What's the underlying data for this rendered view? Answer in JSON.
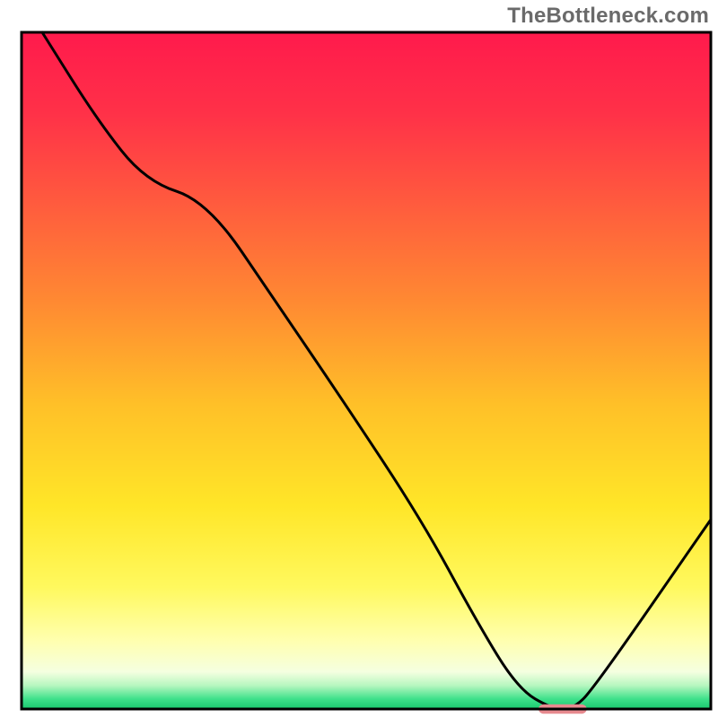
{
  "watermark": "TheBottleneck.com",
  "chart_data": {
    "type": "line",
    "title": "",
    "xlabel": "",
    "ylabel": "",
    "xlim": [
      0,
      100
    ],
    "ylim": [
      0,
      100
    ],
    "grid": false,
    "legend": false,
    "background_gradient": {
      "stops": [
        {
          "offset": 0.0,
          "color": "#ff1a4c"
        },
        {
          "offset": 0.12,
          "color": "#ff3148"
        },
        {
          "offset": 0.25,
          "color": "#ff5a3e"
        },
        {
          "offset": 0.4,
          "color": "#ff8a32"
        },
        {
          "offset": 0.55,
          "color": "#ffc028"
        },
        {
          "offset": 0.7,
          "color": "#ffe628"
        },
        {
          "offset": 0.82,
          "color": "#fff95e"
        },
        {
          "offset": 0.9,
          "color": "#ffffb0"
        },
        {
          "offset": 0.945,
          "color": "#f5ffe0"
        },
        {
          "offset": 0.965,
          "color": "#b8f7c0"
        },
        {
          "offset": 0.985,
          "color": "#3fe18b"
        },
        {
          "offset": 1.0,
          "color": "#18c86e"
        }
      ]
    },
    "series": [
      {
        "name": "bottleneck-curve",
        "color": "#000000",
        "x": [
          3,
          11,
          18,
          27,
          37,
          47,
          58,
          66,
          72,
          77,
          80,
          83,
          100
        ],
        "y": [
          100,
          87,
          78,
          75,
          60,
          45,
          28,
          13,
          3,
          0,
          0,
          3,
          28
        ]
      }
    ],
    "marker": {
      "name": "optimal-range",
      "x_start": 75,
      "x_end": 82,
      "y": 0,
      "color": "#e78a8f",
      "thickness_pct": 1.4
    },
    "axes": {
      "show_ticks": false,
      "show_tick_labels": false,
      "frame": true,
      "frame_color": "#000000"
    }
  }
}
